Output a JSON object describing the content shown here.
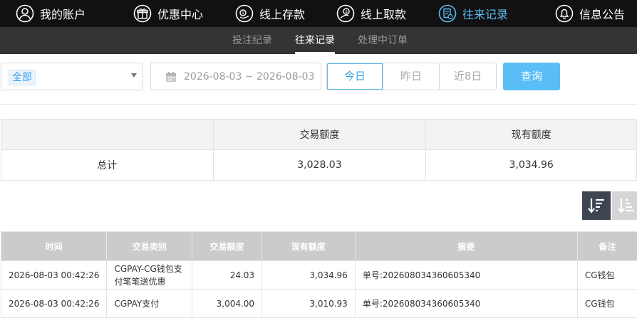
{
  "topnav": {
    "items": [
      {
        "label": "我的账户",
        "icon": "user-icon"
      },
      {
        "label": "优惠中心",
        "icon": "gift-icon"
      },
      {
        "label": "线上存款",
        "icon": "deposit-icon"
      },
      {
        "label": "线上取款",
        "icon": "withdraw-icon"
      },
      {
        "label": "往来记录",
        "icon": "records-icon",
        "active": true
      },
      {
        "label": "信息公告",
        "icon": "bell-icon"
      }
    ]
  },
  "subnav": {
    "items": [
      {
        "label": "投注纪录"
      },
      {
        "label": "往来记录",
        "active": true
      },
      {
        "label": "处理中订单"
      }
    ]
  },
  "filter": {
    "type_selected": "全部",
    "date_range": "2026-08-03 ~ 2026-08-03",
    "quick_ranges": [
      "今日",
      "昨日",
      "近8日"
    ],
    "active_range": "今日",
    "query_label": "查询"
  },
  "summary": {
    "headers": [
      "",
      "交易额度",
      "现有额度"
    ],
    "row": {
      "label": "总计",
      "amount": "3,028.03",
      "balance": "3,034.96"
    }
  },
  "sort": {
    "desc_icon": "sort-desc-icon",
    "asc_icon": "sort-asc-icon"
  },
  "detail": {
    "headers": [
      "时间",
      "交易类别",
      "交易额度",
      "现有额度",
      "摘要",
      "备注"
    ],
    "rows": [
      {
        "time": "2026-08-03 00:42:26",
        "type": "CGPAY-CG钱包支付笔笔送优惠",
        "amount": "24.03",
        "balance": "3,034.96",
        "summary": "单号:202608034360605340",
        "note": "CG钱包"
      },
      {
        "time": "2026-08-03 00:42:26",
        "type": "CGPAY支付",
        "amount": "3,004.00",
        "balance": "3,010.93",
        "summary": "单号:202608034360605340",
        "note": "CG钱包"
      }
    ]
  },
  "colors": {
    "accent": "#5bbdf5",
    "nav_bg": "#111111",
    "subnav_bg": "#343434",
    "header_bg": "#cbcbcb"
  }
}
